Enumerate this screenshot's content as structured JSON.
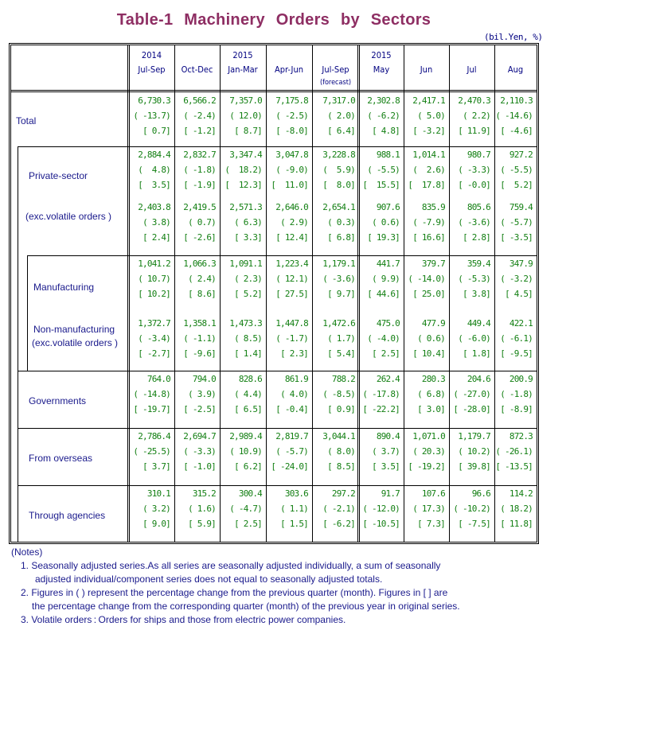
{
  "title": "Table-1   Machinery   Orders   by   Sectors",
  "unit": "(bil.Yen, %)",
  "columns": [
    {
      "year": "2014",
      "period": "Jul-Sep",
      "note": ""
    },
    {
      "year": "",
      "period": "Oct-Dec",
      "note": ""
    },
    {
      "year": "2015",
      "period": "Jan-Mar",
      "note": ""
    },
    {
      "year": "",
      "period": "Apr-Jun",
      "note": ""
    },
    {
      "year": "",
      "period": "Jul-Sep",
      "note": "(forecast)"
    },
    {
      "year": "2015",
      "period": "May",
      "note": ""
    },
    {
      "year": "",
      "period": "Jun",
      "note": ""
    },
    {
      "year": "",
      "period": "Jul",
      "note": ""
    },
    {
      "year": "",
      "period": "Aug",
      "note": ""
    }
  ],
  "rows": [
    {
      "label": "Total",
      "values": [
        "6,730.3",
        "6,566.2",
        "7,357.0",
        "7,175.8",
        "7,317.0",
        "2,302.8",
        "2,417.1",
        "2,470.3",
        "2,110.3"
      ],
      "qoq": [
        "( -13.7)",
        "( -2.4)",
        "( 12.0)",
        "( -2.5)",
        "( 2.0)",
        "( -6.2)",
        "( 5.0)",
        "( 2.2)",
        "( -14.6)"
      ],
      "yoy": [
        "[ 0.7]",
        "[ -1.2]",
        "[ 8.7]",
        "[ -8.0]",
        "[ 6.4]",
        "[ 4.8]",
        "[ -3.2]",
        "[ 11.9]",
        "[ -4.6]"
      ]
    },
    {
      "label": "Private-sector",
      "values": [
        "2,884.4",
        "2,832.7",
        "3,347.4",
        "3,047.8",
        "3,228.8",
        "988.1",
        "1,014.1",
        "980.7",
        "927.2"
      ],
      "qoq": [
        "(  4.8)",
        "( -1.8)",
        "(  18.2)",
        "( -9.0)",
        "(  5.9)",
        "( -5.5)",
        "(  2.6)",
        "( -3.3)",
        "( -5.5)"
      ],
      "yoy": [
        "[  3.5]",
        "[ -1.9]",
        "[  12.3]",
        "[  11.0]",
        "[  8.0]",
        "[  15.5]",
        "[  17.8]",
        "[ -0.0]",
        "[  5.2]"
      ]
    },
    {
      "label": "(exc.volatile orders )",
      "values": [
        "2,403.8",
        "2,419.5",
        "2,571.3",
        "2,646.0",
        "2,654.1",
        "907.6",
        "835.9",
        "805.6",
        "759.4"
      ],
      "qoq": [
        "( 3.8)",
        "( 0.7)",
        "( 6.3)",
        "( 2.9)",
        "( 0.3)",
        "( 0.6)",
        "( -7.9)",
        "( -3.6)",
        "( -5.7)"
      ],
      "yoy": [
        "[ 2.4]",
        "[ -2.6]",
        "[ 3.3]",
        "[ 12.4]",
        "[ 6.8]",
        "[ 19.3]",
        "[ 16.6]",
        "[ 2.8]",
        "[ -3.5]"
      ]
    },
    {
      "label": "Manufacturing",
      "values": [
        "1,041.2",
        "1,066.3",
        "1,091.1",
        "1,223.4",
        "1,179.1",
        "441.7",
        "379.7",
        "359.4",
        "347.9"
      ],
      "qoq": [
        "( 10.7)",
        "( 2.4)",
        "( 2.3)",
        "( 12.1)",
        "( -3.6)",
        "( 9.9)",
        "( -14.0)",
        "( -5.3)",
        "( -3.2)"
      ],
      "yoy": [
        "[ 10.2]",
        "[ 8.6]",
        "[ 5.2]",
        "[ 27.5]",
        "[ 9.7]",
        "[ 44.6]",
        "[ 25.0]",
        "[ 3.8]",
        "[ 4.5]"
      ]
    },
    {
      "label": "Non-manufacturing",
      "label2": "(exc.volatile orders )",
      "values": [
        "1,372.7",
        "1,358.1",
        "1,473.3",
        "1,447.8",
        "1,472.6",
        "475.0",
        "477.9",
        "449.4",
        "422.1"
      ],
      "qoq": [
        "( -3.4)",
        "( -1.1)",
        "( 8.5)",
        "( -1.7)",
        "( 1.7)",
        "( -4.0)",
        "( 0.6)",
        "( -6.0)",
        "( -6.1)"
      ],
      "yoy": [
        "[ -2.7]",
        "[ -9.6]",
        "[ 1.4]",
        "[ 2.3]",
        "[ 5.4]",
        "[ 2.5]",
        "[ 10.4]",
        "[ 1.8]",
        "[ -9.5]"
      ]
    },
    {
      "label": "Governments",
      "values": [
        "764.0",
        "794.0",
        "828.6",
        "861.9",
        "788.2",
        "262.4",
        "280.3",
        "204.6",
        "200.9"
      ],
      "qoq": [
        "( -14.8)",
        "( 3.9)",
        "( 4.4)",
        "( 4.0)",
        "( -8.5)",
        "( -17.8)",
        "( 6.8)",
        "( -27.0)",
        "( -1.8)"
      ],
      "yoy": [
        "[ -19.7]",
        "[ -2.5]",
        "[ 6.5]",
        "[ -0.4]",
        "[ 0.9]",
        "[ -22.2]",
        "[ 3.0]",
        "[ -28.0]",
        "[ -8.9]"
      ]
    },
    {
      "label": "From overseas",
      "values": [
        "2,786.4",
        "2,694.7",
        "2,989.4",
        "2,819.7",
        "3,044.1",
        "890.4",
        "1,071.0",
        "1,179.7",
        "872.3"
      ],
      "qoq": [
        "( -25.5)",
        "( -3.3)",
        "( 10.9)",
        "( -5.7)",
        "( 8.0)",
        "( 3.7)",
        "( 20.3)",
        "( 10.2)",
        "( -26.1)"
      ],
      "yoy": [
        "[ 3.7]",
        "[ -1.0]",
        "[ 6.2]",
        "[ -24.0]",
        "[ 8.5]",
        "[ 3.5]",
        "[ -19.2]",
        "[ 39.8]",
        "[ -13.5]"
      ]
    },
    {
      "label": "Through agencies",
      "values": [
        "310.1",
        "315.2",
        "300.4",
        "303.6",
        "297.2",
        "91.7",
        "107.6",
        "96.6",
        "114.2"
      ],
      "qoq": [
        "( 3.2)",
        "( 1.6)",
        "( -4.7)",
        "( 1.1)",
        "( -2.1)",
        "( -12.0)",
        "( 17.3)",
        "( -10.2)",
        "( 18.2)"
      ],
      "yoy": [
        "[ 9.0]",
        "[ 5.9]",
        "[ 2.5]",
        "[ 1.5]",
        "[ -6.2]",
        "[ -10.5]",
        "[ 7.3]",
        "[ -7.5]",
        "[ 11.8]"
      ]
    }
  ],
  "notes": {
    "heading": "(Notes)",
    "lines": [
      "1. Seasonally adjusted series.As all series are seasonally adjusted individually, a sum of seasonally",
      "    adjusted individual/component series does not equal to seasonally adjusted totals.",
      "2. Figures in ( ) represent the percentage change from the previous quarter (month). Figures in [ ] are",
      "   the percentage change from the corresponding quarter (month) of the previous year in original series.",
      "3. Volatile orders : Orders for ships and those from electric power companies."
    ]
  }
}
